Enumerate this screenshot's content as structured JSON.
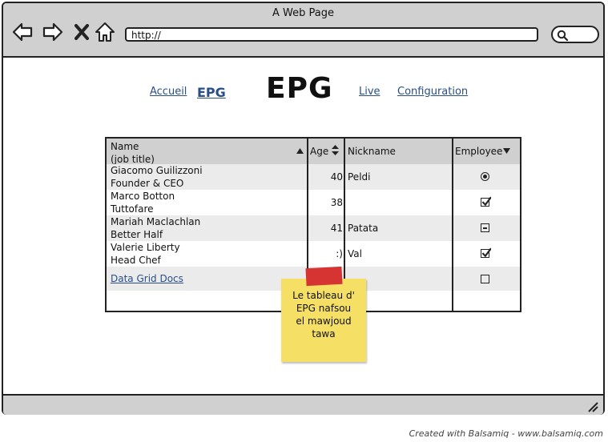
{
  "window": {
    "title": "A Web Page"
  },
  "toolbar": {
    "url": "http://"
  },
  "nav": {
    "links": [
      "Accueil",
      "EPG",
      "Live",
      "Configuration"
    ],
    "heading": "EPG"
  },
  "grid": {
    "columns": [
      {
        "label_line1": "Name",
        "label_line2": "(job title)",
        "sort": "asc"
      },
      {
        "label": "Age",
        "sort": "both"
      },
      {
        "label": "Nickname"
      },
      {
        "label": "Employee",
        "sort": "desc"
      }
    ],
    "rows": [
      {
        "name": "Giacomo Guilizzoni",
        "title": "Founder & CEO",
        "age": "40",
        "nickname": "Peldi",
        "employee": "radio-selected"
      },
      {
        "name": "Marco Botton",
        "title": "Tuttofare",
        "age": "38",
        "nickname": "",
        "employee": "checked"
      },
      {
        "name": "Mariah Maclachlan",
        "title": "Better Half",
        "age": "41",
        "nickname": "Patata",
        "employee": "indeterminate"
      },
      {
        "name": "Valerie Liberty",
        "title": "Head Chef",
        "age": ":)",
        "nickname": "Val",
        "employee": "checked"
      },
      {
        "link": "Data Grid Docs",
        "employee": "unchecked"
      }
    ]
  },
  "note": {
    "text_lines": [
      "Le tableau d'",
      "EPG nafsou",
      "el mawjoud",
      "tawa"
    ]
  },
  "footer": {
    "credit": "Created with Balsamiq - www.balsamiq.com"
  },
  "colors": {
    "link": "#2a4f86",
    "chrome": "#d0d0d0",
    "sticky": "#f5e065",
    "tape": "#d63333"
  }
}
